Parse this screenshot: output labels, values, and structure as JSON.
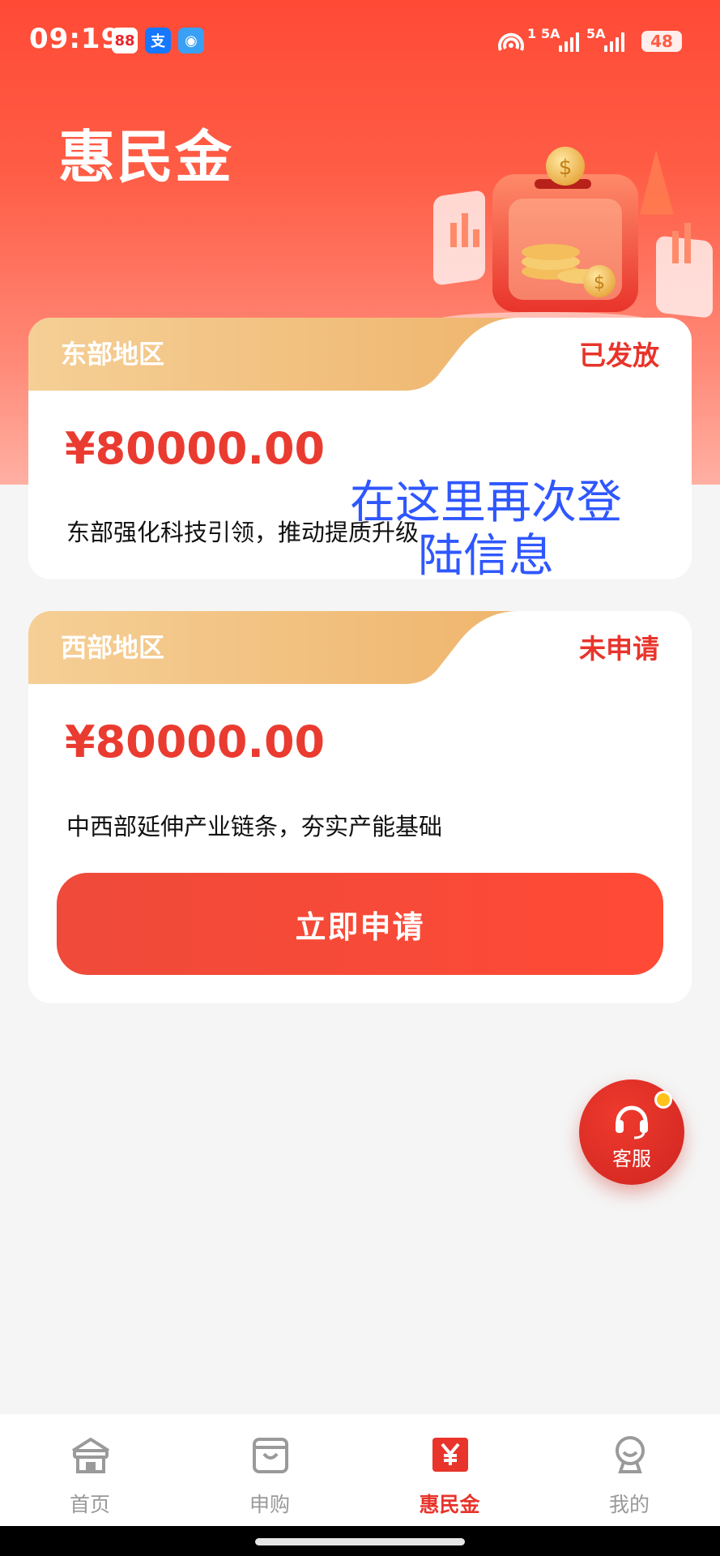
{
  "status_bar": {
    "time": "09:19",
    "app_icons": [
      "88",
      "支",
      "◉"
    ],
    "net1": "1",
    "net2": "5A",
    "net3": "5A",
    "battery": "48"
  },
  "page": {
    "title": "惠民金"
  },
  "cards": [
    {
      "region": "东部地区",
      "status": "已发放",
      "amount": "¥80000.00",
      "desc": "东部强化科技引领，推动提质升级"
    },
    {
      "region": "西部地区",
      "status": "未申请",
      "amount": "¥80000.00",
      "desc": "中西部延伸产业链条，夯实产能基础",
      "button": "立即申请"
    }
  ],
  "overlay_text": {
    "line1": "在这里再次登",
    "line2": "陆信息"
  },
  "customer_service": {
    "label": "客服"
  },
  "tabbar": {
    "tabs": [
      {
        "label": "首页",
        "icon": "home-icon"
      },
      {
        "label": "申购",
        "icon": "bag-icon"
      },
      {
        "label": "惠民金",
        "icon": "yen-icon",
        "active": true
      },
      {
        "label": "我的",
        "icon": "profile-icon"
      }
    ]
  },
  "colors": {
    "accent": "#e8342b",
    "hero": "#ff4a36",
    "head_gold": "#f3c07f"
  }
}
